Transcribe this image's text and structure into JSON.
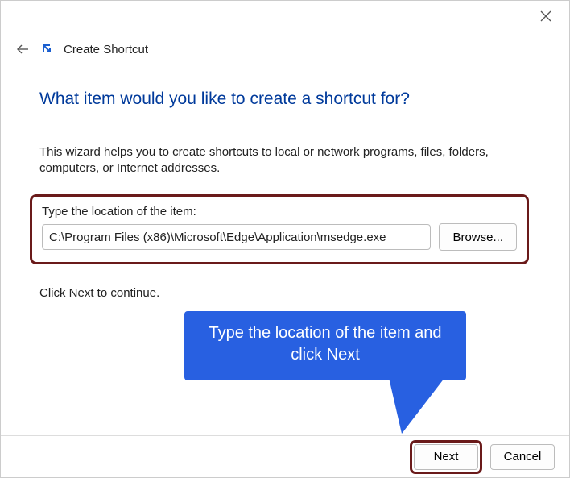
{
  "window": {
    "title": "Create Shortcut",
    "heading": "What item would you like to create a shortcut for?",
    "description": "This wizard helps you to create shortcuts to local or network programs, files, folders, computers, or Internet addresses."
  },
  "field": {
    "label": "Type the location of the item:",
    "value": "C:\\Program Files (x86)\\Microsoft\\Edge\\Application\\msedge.exe",
    "browse_label": "Browse..."
  },
  "continue_text": "Click Next to continue.",
  "callout": {
    "text": "Type the location of the item and click Next"
  },
  "footer": {
    "next_label": "Next",
    "cancel_label": "Cancel"
  }
}
